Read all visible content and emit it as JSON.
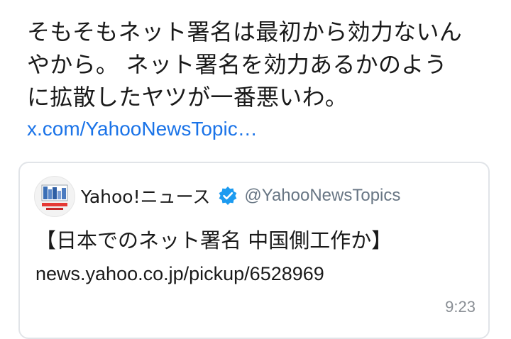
{
  "tweet": {
    "lines": [
      "そもそもネット署名は最初から効力ないん",
      "やから。 ネット署名を効力あるかのよう",
      "に拡散したヤツが一番悪いわ。"
    ],
    "link": "x.com/YahooNewsTopic…"
  },
  "quote": {
    "author_name": "Yahoo!ニュース",
    "author_handle": "@YahooNewsTopics",
    "verified_icon": "verified-badge-icon",
    "avatar_icon": "yahoo-news-logo-icon",
    "title": "【日本でのネット署名 中国側工作か】",
    "url": "news.yahoo.co.jp/pickup/6528969",
    "timestamp": "9:23"
  },
  "colors": {
    "link": "#1a73e8",
    "verified": "#1d9bf0",
    "handle": "#687684",
    "border": "#e1e4e8"
  }
}
